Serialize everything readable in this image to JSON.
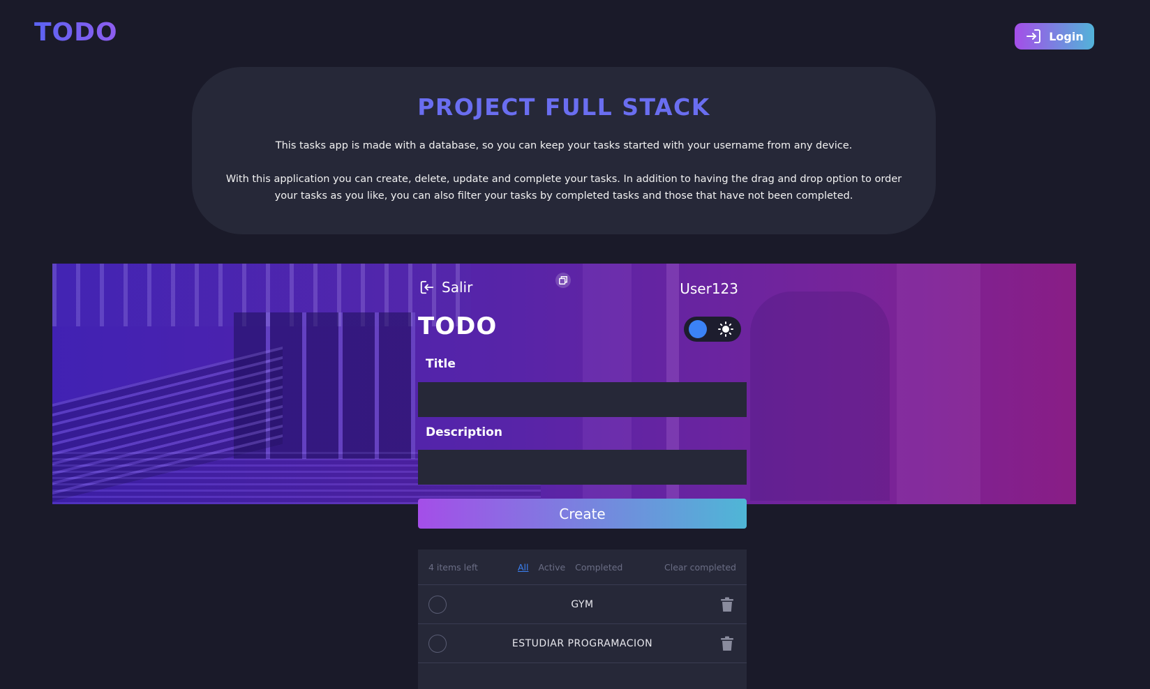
{
  "nav": {
    "brand": "TODO",
    "login_label": "Login"
  },
  "intro": {
    "title": "PROJECT FULL STACK",
    "paragraph1": "This tasks app is made with a database, so you can keep your tasks started with your username from any device.",
    "paragraph2": "With this application you can create, delete, update and complete your tasks. In addition to having the drag and drop option to order your tasks as you like, you can also filter your tasks by completed tasks and those that have not been completed."
  },
  "app": {
    "logout_label": "Salir",
    "username": "User123",
    "title": "TODO",
    "title_label": "Title",
    "description_label": "Description",
    "title_value": "",
    "description_value": "",
    "create_label": "Create",
    "theme": "dark"
  },
  "list": {
    "items_left": "4 items left",
    "filters": [
      "All",
      "Active",
      "Completed"
    ],
    "active_filter": "All",
    "clear_label": "Clear completed",
    "tasks": [
      {
        "title": "GYM",
        "completed": false
      },
      {
        "title": "ESTUDIAR PROGRAMACION",
        "completed": false
      }
    ]
  },
  "colors": {
    "background": "#1a1a29",
    "card": "#262838",
    "accent_purple": "#a44ee8",
    "accent_cyan": "#4fb6d6",
    "title_blue": "#6a6ef0",
    "toggle_knob": "#3b82f6"
  },
  "icons": {
    "login": "login-icon",
    "logout": "logout-icon",
    "copy": "copy-icon",
    "theme": "sun-icon",
    "delete": "trash-icon"
  }
}
